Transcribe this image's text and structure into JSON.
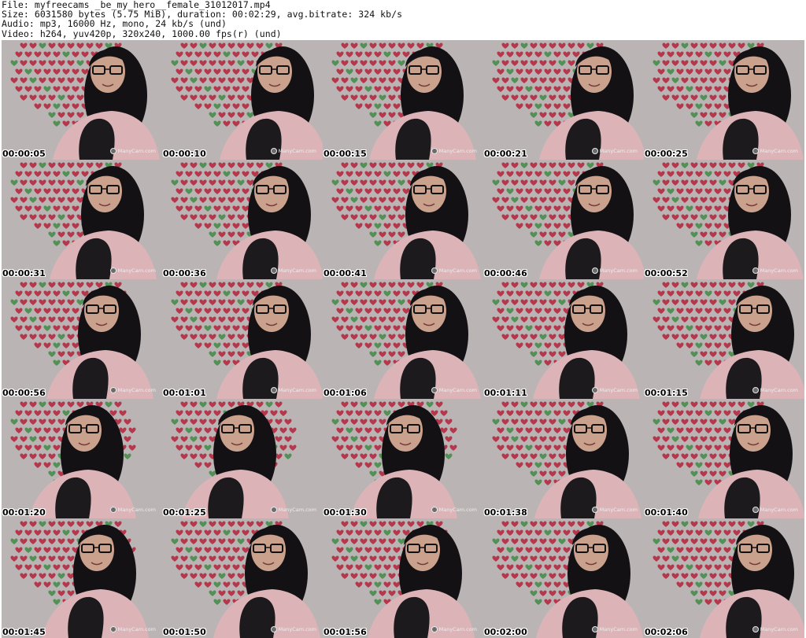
{
  "header": {
    "file_line": "File: myfreecams _be_my_hero__female_31012017.mp4",
    "size_line": "Size: 6031580 bytes (5.75 MiB), duration: 00:02:29, avg.bitrate: 324 kb/s",
    "audio_line": "Audio: mp3, 16000 Hz, mono, 24 kb/s (und)",
    "video_line": "Video: h264, yuv420p, 320x240, 1000.00 fps(r) (und)"
  },
  "watermark": "ManyCam.com",
  "colors": {
    "heart_red": "#b3213a",
    "heart_green": "#3f8a44",
    "wall": "#bab5b4",
    "sweater": "#dcb4b8",
    "tights": "#1c1a1d",
    "hair": "#141114",
    "skin": "#c9a18d"
  },
  "thumbnails": [
    {
      "timestamp": "00:00:05"
    },
    {
      "timestamp": "00:00:10"
    },
    {
      "timestamp": "00:00:15"
    },
    {
      "timestamp": "00:00:21"
    },
    {
      "timestamp": "00:00:25"
    },
    {
      "timestamp": "00:00:31"
    },
    {
      "timestamp": "00:00:36"
    },
    {
      "timestamp": "00:00:41"
    },
    {
      "timestamp": "00:00:46"
    },
    {
      "timestamp": "00:00:52"
    },
    {
      "timestamp": "00:00:56"
    },
    {
      "timestamp": "00:01:01"
    },
    {
      "timestamp": "00:01:06"
    },
    {
      "timestamp": "00:01:11"
    },
    {
      "timestamp": "00:01:15"
    },
    {
      "timestamp": "00:01:20"
    },
    {
      "timestamp": "00:01:25"
    },
    {
      "timestamp": "00:01:30"
    },
    {
      "timestamp": "00:01:38"
    },
    {
      "timestamp": "00:01:40"
    },
    {
      "timestamp": "00:01:45"
    },
    {
      "timestamp": "00:01:50"
    },
    {
      "timestamp": "00:01:56"
    },
    {
      "timestamp": "00:02:00"
    },
    {
      "timestamp": "00:02:06"
    }
  ]
}
